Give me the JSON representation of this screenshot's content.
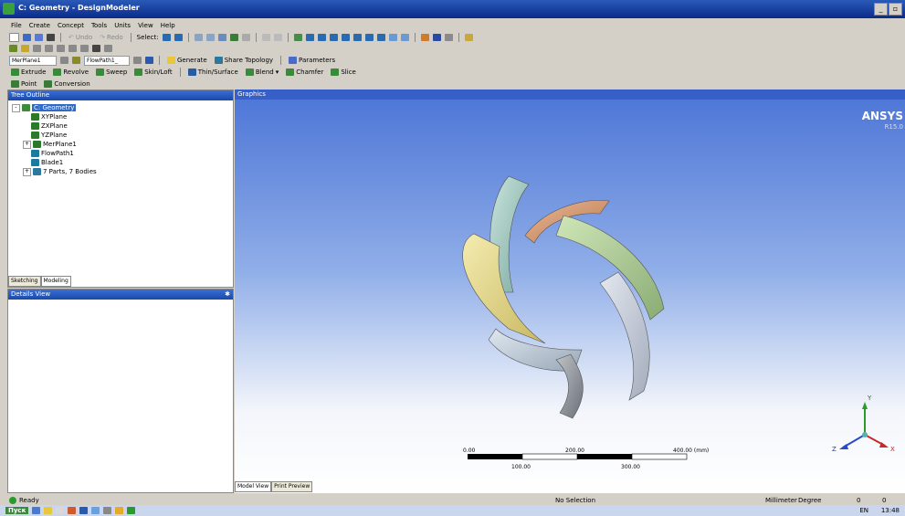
{
  "window": {
    "title": "C: Geometry - DesignModeler"
  },
  "menu": [
    "File",
    "Create",
    "Concept",
    "Tools",
    "Units",
    "View",
    "Help"
  ],
  "toolbar1": {
    "undo": "Undo",
    "redo": "Redo",
    "select_label": "Select:"
  },
  "toolbar3": {
    "plane_combo": "MerPlane1",
    "sketch_combo": "FlowPath1_",
    "generate": "Generate",
    "share_topology": "Share Topology",
    "parameters": "Parameters"
  },
  "toolbar4": [
    "Extrude",
    "Revolve",
    "Sweep",
    "Skin/Loft",
    "Thin/Surface",
    "Blend",
    "Chamfer",
    "Slice"
  ],
  "toolbar5": [
    "Point",
    "Conversion"
  ],
  "tree": {
    "header": "Tree Outline",
    "items": [
      {
        "label": "C: Geometry",
        "depth": 0,
        "expander": "-",
        "color": "#3c8c3c",
        "selected": true
      },
      {
        "label": "XYPlane",
        "depth": 1,
        "expander": "",
        "color": "#2a7a2a"
      },
      {
        "label": "ZXPlane",
        "depth": 1,
        "expander": "",
        "color": "#2a7a2a"
      },
      {
        "label": "YZPlane",
        "depth": 1,
        "expander": "",
        "color": "#2a7a2a"
      },
      {
        "label": "MerPlane1",
        "depth": 1,
        "expander": "+",
        "color": "#2a7a2a"
      },
      {
        "label": "FlowPath1",
        "depth": 1,
        "expander": "",
        "color": "#1a7aa0"
      },
      {
        "label": "Blade1",
        "depth": 1,
        "expander": "",
        "color": "#1a7aa0"
      },
      {
        "label": "7 Parts, 7 Bodies",
        "depth": 1,
        "expander": "+",
        "color": "#2a7aa0"
      }
    ],
    "tabs": [
      "Sketching",
      "Modeling"
    ],
    "active_tab": "Modeling"
  },
  "details": {
    "header": "Details View"
  },
  "graphics": {
    "header": "Graphics",
    "brand": "ANSYS",
    "version": "R15.0",
    "scale": {
      "top_labels": [
        "0.00",
        "200.00",
        "400.00 (mm)"
      ],
      "bottom_labels": [
        "100.00",
        "300.00"
      ]
    },
    "axes": {
      "y": "Y",
      "x": "X",
      "z": "Z"
    },
    "tabs": [
      "Model View",
      "Print Preview"
    ]
  },
  "status": {
    "ready": "Ready",
    "selection": "No Selection",
    "units": "Millimeter",
    "angle": "Degree",
    "value1": "0",
    "value2": "0"
  },
  "taskbar": {
    "start": "Пуск",
    "lang": "EN",
    "time": "13:48"
  },
  "colors": {
    "accent": "#1a4aa8",
    "blade_yellow": "#e8dc8a",
    "blade_green": "#b8d4a0",
    "blade_cyan": "#a8d0c8",
    "blade_orange": "#d8a078",
    "blade_gray": "#9aa4ae"
  }
}
